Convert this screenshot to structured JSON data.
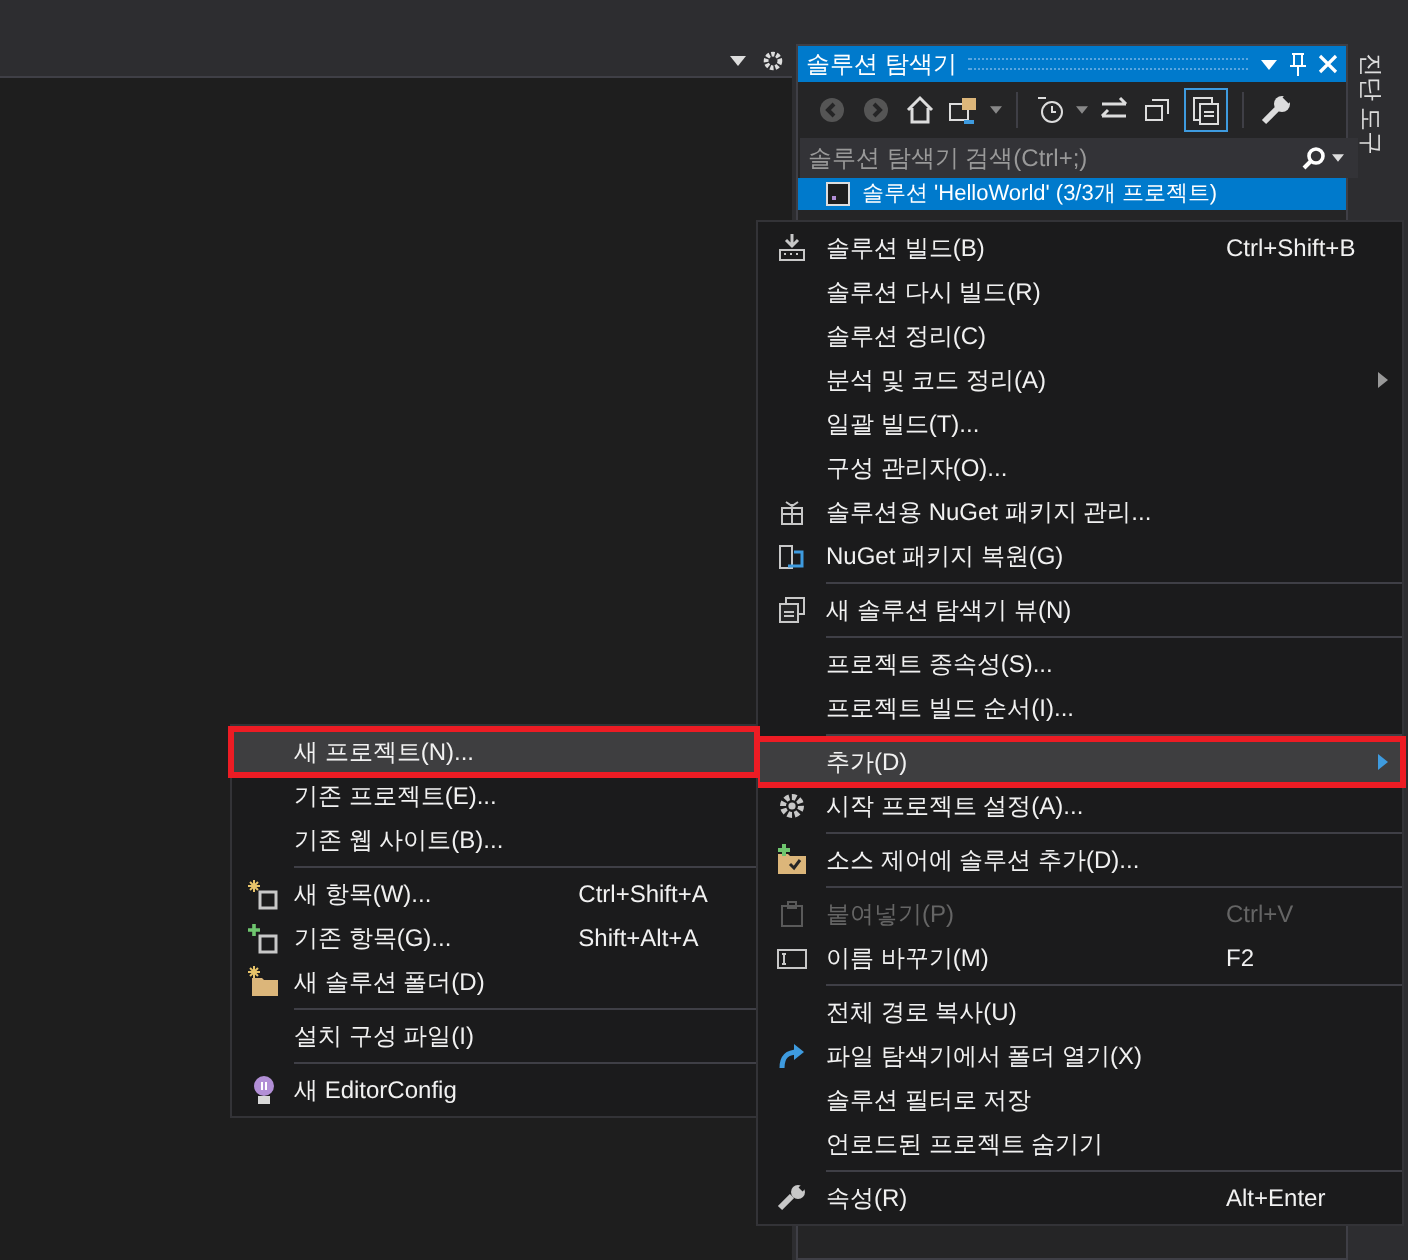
{
  "solution_explorer": {
    "title": "솔루션 탐색기",
    "search": {
      "placeholder": "솔루션 탐색기 검색(Ctrl+;)"
    },
    "tree": [
      {
        "label": "솔루션 'HelloWorld' (3/3개 프로젝트)",
        "selected": true
      }
    ]
  },
  "side_tab": {
    "label": "진단 도구"
  },
  "context_menu": [
    {
      "kind": "item",
      "label": "솔루션 빌드(B)",
      "shortcut": "Ctrl+Shift+B",
      "selected": false,
      "disabled": false,
      "submenu": false,
      "annotated": false
    },
    {
      "kind": "item",
      "label": "솔루션 다시 빌드(R)",
      "selected": false,
      "disabled": false,
      "submenu": false,
      "annotated": false
    },
    {
      "kind": "item",
      "label": "솔루션 정리(C)",
      "selected": false,
      "disabled": false,
      "submenu": false,
      "annotated": false
    },
    {
      "kind": "item",
      "label": "분석 및 코드 정리(A)",
      "selected": false,
      "disabled": false,
      "submenu": true,
      "annotated": false
    },
    {
      "kind": "item",
      "label": "일괄 빌드(T)...",
      "selected": false,
      "disabled": false,
      "submenu": false,
      "annotated": false
    },
    {
      "kind": "item",
      "label": "구성 관리자(O)...",
      "selected": false,
      "disabled": false,
      "submenu": false,
      "annotated": false
    },
    {
      "kind": "item",
      "label": "솔루션용 NuGet 패키지 관리...",
      "selected": false,
      "disabled": false,
      "submenu": false,
      "annotated": false
    },
    {
      "kind": "item",
      "label": "NuGet 패키지 복원(G)",
      "selected": false,
      "disabled": false,
      "submenu": false,
      "annotated": false
    },
    {
      "kind": "separator"
    },
    {
      "kind": "item",
      "label": "새 솔루션 탐색기 뷰(N)",
      "selected": false,
      "disabled": false,
      "submenu": false,
      "annotated": false
    },
    {
      "kind": "separator"
    },
    {
      "kind": "item",
      "label": "프로젝트 종속성(S)...",
      "selected": false,
      "disabled": false,
      "submenu": false,
      "annotated": false
    },
    {
      "kind": "item",
      "label": "프로젝트 빌드 순서(I)...",
      "selected": false,
      "disabled": false,
      "submenu": false,
      "annotated": false
    },
    {
      "kind": "separator"
    },
    {
      "kind": "item",
      "label": "추가(D)",
      "selected": true,
      "disabled": false,
      "submenu": true,
      "annotated": true
    },
    {
      "kind": "item",
      "label": "시작 프로젝트 설정(A)...",
      "selected": false,
      "disabled": false,
      "submenu": false,
      "annotated": false
    },
    {
      "kind": "separator"
    },
    {
      "kind": "item",
      "label": "소스 제어에 솔루션 추가(D)...",
      "selected": false,
      "disabled": false,
      "submenu": false,
      "annotated": false
    },
    {
      "kind": "separator"
    },
    {
      "kind": "item",
      "label": "붙여넣기(P)",
      "shortcut": "Ctrl+V",
      "selected": false,
      "disabled": true,
      "submenu": false,
      "annotated": false
    },
    {
      "kind": "item",
      "label": "이름 바꾸기(M)",
      "shortcut": "F2",
      "selected": false,
      "disabled": false,
      "submenu": false,
      "annotated": false
    },
    {
      "kind": "separator"
    },
    {
      "kind": "item",
      "label": "전체 경로 복사(U)",
      "selected": false,
      "disabled": false,
      "submenu": false,
      "annotated": false
    },
    {
      "kind": "item",
      "label": "파일 탐색기에서 폴더 열기(X)",
      "selected": false,
      "disabled": false,
      "submenu": false,
      "annotated": false
    },
    {
      "kind": "item",
      "label": "솔루션 필터로 저장",
      "selected": false,
      "disabled": false,
      "submenu": false,
      "annotated": false
    },
    {
      "kind": "item",
      "label": "언로드된 프로젝트 숨기기",
      "selected": false,
      "disabled": false,
      "submenu": false,
      "annotated": false
    },
    {
      "kind": "separator"
    },
    {
      "kind": "item",
      "label": "속성(R)",
      "shortcut": "Alt+Enter",
      "selected": false,
      "disabled": false,
      "submenu": false,
      "annotated": false
    }
  ],
  "submenu": [
    {
      "kind": "item",
      "label": "새 프로젝트(N)...",
      "selected": true,
      "disabled": false,
      "submenu": false,
      "annotated": true
    },
    {
      "kind": "item",
      "label": "기존 프로젝트(E)...",
      "selected": false,
      "disabled": false,
      "submenu": false,
      "annotated": false
    },
    {
      "kind": "item",
      "label": "기존 웹 사이트(B)...",
      "selected": false,
      "disabled": false,
      "submenu": false,
      "annotated": false
    },
    {
      "kind": "separator"
    },
    {
      "kind": "item",
      "label": "새 항목(W)...",
      "shortcut": "Ctrl+Shift+A",
      "selected": false,
      "disabled": false,
      "submenu": false,
      "annotated": false
    },
    {
      "kind": "item",
      "label": "기존 항목(G)...",
      "shortcut": "Shift+Alt+A",
      "selected": false,
      "disabled": false,
      "submenu": false,
      "annotated": false
    },
    {
      "kind": "item",
      "label": "새 솔루션 폴더(D)",
      "selected": false,
      "disabled": false,
      "submenu": false,
      "annotated": false
    },
    {
      "kind": "separator"
    },
    {
      "kind": "item",
      "label": "설치 구성 파일(I)",
      "selected": false,
      "disabled": false,
      "submenu": false,
      "annotated": false
    },
    {
      "kind": "separator"
    },
    {
      "kind": "item",
      "label": "새 EditorConfig",
      "selected": false,
      "disabled": false,
      "submenu": false,
      "annotated": false
    }
  ]
}
